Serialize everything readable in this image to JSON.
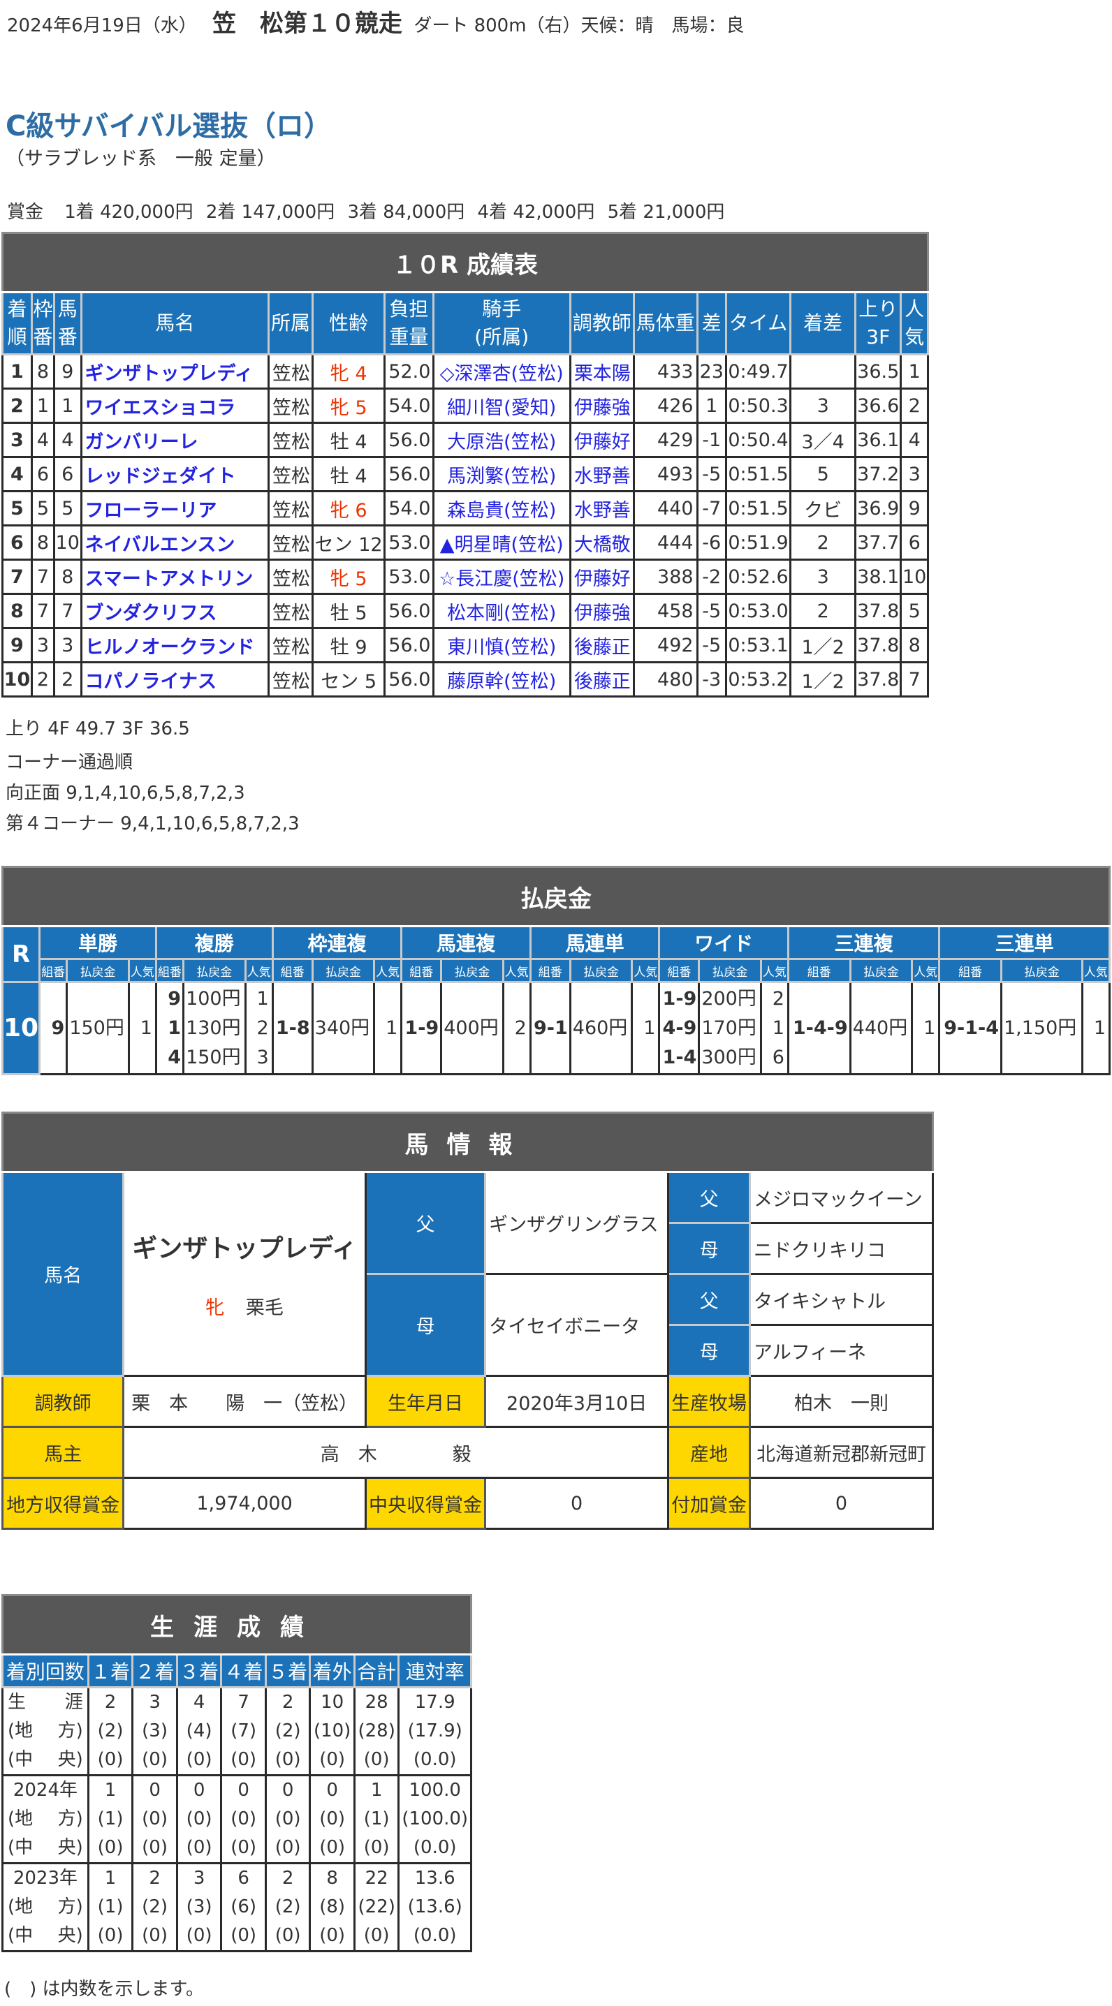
{
  "header": {
    "date": "2024年6月19日（水）",
    "venue_race": "笠　松第１０競走",
    "conditions": "ダート 800m（右）天候：晴　馬場：良",
    "race_name": "C級サバイバル選抜（ロ）",
    "race_class": "（サラブレッド系　一般 定量）",
    "prize_label": "賞金",
    "prizes": [
      "1着 420,000円",
      "2着 147,000円",
      "3着 84,000円",
      "4着 42,000円",
      "5着 21,000円"
    ]
  },
  "results": {
    "title": "１０R 成績表",
    "headers": [
      "着\n順",
      "枠\n番",
      "馬\n番",
      "馬名",
      "所属",
      "性齢",
      "負担\n重量",
      "騎手\n(所属)",
      "調教師",
      "馬体重",
      "差",
      "タイム",
      "着差",
      "上り\n3F",
      "人\n気"
    ],
    "rows": [
      {
        "rank": "1",
        "waku": "8",
        "num": "9",
        "name": "ギンザトップレディ",
        "belong": "笠松",
        "sex": "牝 4",
        "female": true,
        "weight": "52.0",
        "jockey": "◇深澤杏(笠松)",
        "trainer": "栗本陽",
        "body": "433",
        "diff": "23",
        "time": "0:49.7",
        "margin": "",
        "last3f": "36.5",
        "pop": "1"
      },
      {
        "rank": "2",
        "waku": "1",
        "num": "1",
        "name": "ワイエスショコラ",
        "belong": "笠松",
        "sex": "牝 5",
        "female": true,
        "weight": "54.0",
        "jockey": "細川智(愛知)",
        "trainer": "伊藤強",
        "body": "426",
        "diff": "1",
        "time": "0:50.3",
        "margin": "3",
        "last3f": "36.6",
        "pop": "2"
      },
      {
        "rank": "3",
        "waku": "4",
        "num": "4",
        "name": "ガンバリーレ",
        "belong": "笠松",
        "sex": "牡 4",
        "female": false,
        "weight": "56.0",
        "jockey": "大原浩(笠松)",
        "trainer": "伊藤好",
        "body": "429",
        "diff": "-1",
        "time": "0:50.4",
        "margin": "3／4",
        "last3f": "36.1",
        "pop": "4"
      },
      {
        "rank": "4",
        "waku": "6",
        "num": "6",
        "name": "レッドジェダイト",
        "belong": "笠松",
        "sex": "牡 4",
        "female": false,
        "weight": "56.0",
        "jockey": "馬渕繁(笠松)",
        "trainer": "水野善",
        "body": "493",
        "diff": "-5",
        "time": "0:51.5",
        "margin": "5",
        "last3f": "37.2",
        "pop": "3"
      },
      {
        "rank": "5",
        "waku": "5",
        "num": "5",
        "name": "フローラーリア",
        "belong": "笠松",
        "sex": "牝 6",
        "female": true,
        "weight": "54.0",
        "jockey": "森島貴(笠松)",
        "trainer": "水野善",
        "body": "440",
        "diff": "-7",
        "time": "0:51.5",
        "margin": "クビ",
        "last3f": "36.9",
        "pop": "9"
      },
      {
        "rank": "6",
        "waku": "8",
        "num": "10",
        "name": "ネイバルエンスン",
        "belong": "笠松",
        "sex": "セン 12",
        "female": false,
        "weight": "53.0",
        "jockey": "▲明星晴(笠松)",
        "trainer": "大橋敬",
        "body": "444",
        "diff": "-6",
        "time": "0:51.9",
        "margin": "2",
        "last3f": "37.7",
        "pop": "6"
      },
      {
        "rank": "7",
        "waku": "7",
        "num": "8",
        "name": "スマートアメトリン",
        "belong": "笠松",
        "sex": "牝 5",
        "female": true,
        "weight": "53.0",
        "jockey": "☆長江慶(笠松)",
        "trainer": "伊藤好",
        "body": "388",
        "diff": "-2",
        "time": "0:52.6",
        "margin": "3",
        "last3f": "38.1",
        "pop": "10"
      },
      {
        "rank": "8",
        "waku": "7",
        "num": "7",
        "name": "ブンダクリフス",
        "belong": "笠松",
        "sex": "牡 5",
        "female": false,
        "weight": "56.0",
        "jockey": "松本剛(笠松)",
        "trainer": "伊藤強",
        "body": "458",
        "diff": "-5",
        "time": "0:53.0",
        "margin": "2",
        "last3f": "37.8",
        "pop": "5"
      },
      {
        "rank": "9",
        "waku": "3",
        "num": "3",
        "name": "ヒルノオークランド",
        "belong": "笠松",
        "sex": "牡 9",
        "female": false,
        "weight": "56.0",
        "jockey": "東川慎(笠松)",
        "trainer": "後藤正",
        "body": "492",
        "diff": "-5",
        "time": "0:53.1",
        "margin": "1／2",
        "last3f": "37.8",
        "pop": "8"
      },
      {
        "rank": "10",
        "waku": "2",
        "num": "2",
        "name": "コパノライナス",
        "belong": "笠松",
        "sex": "セン 5",
        "female": false,
        "weight": "56.0",
        "jockey": "藤原幹(笠松)",
        "trainer": "後藤正",
        "body": "480",
        "diff": "-3",
        "time": "0:53.2",
        "margin": "1／2",
        "last3f": "37.8",
        "pop": "7"
      }
    ]
  },
  "notes": {
    "last_furlongs": "上り 4F 49.7 3F 36.5",
    "corner_title": "コーナー通過順",
    "corners": [
      "向正面 9,1,4,10,6,5,8,7,2,3",
      "第４コーナー 9,4,1,10,6,5,8,7,2,3"
    ]
  },
  "payout": {
    "title": "払戻金",
    "r_label": "R",
    "race_no": "10",
    "sub_headers": [
      "組番",
      "払戻金",
      "人気"
    ],
    "bets": [
      {
        "name": "単勝",
        "entries": [
          {
            "combo": "9",
            "amount": "150円",
            "pop": "1"
          }
        ]
      },
      {
        "name": "複勝",
        "entries": [
          {
            "combo": "9",
            "amount": "100円",
            "pop": "1"
          },
          {
            "combo": "1",
            "amount": "130円",
            "pop": "2"
          },
          {
            "combo": "4",
            "amount": "150円",
            "pop": "3"
          }
        ]
      },
      {
        "name": "枠連複",
        "entries": [
          {
            "combo": "1-8",
            "amount": "340円",
            "pop": "1"
          }
        ]
      },
      {
        "name": "馬連複",
        "entries": [
          {
            "combo": "1-9",
            "amount": "400円",
            "pop": "2"
          }
        ]
      },
      {
        "name": "馬連単",
        "entries": [
          {
            "combo": "9-1",
            "amount": "460円",
            "pop": "1"
          }
        ]
      },
      {
        "name": "ワイド",
        "entries": [
          {
            "combo": "1-9",
            "amount": "200円",
            "pop": "2"
          },
          {
            "combo": "4-9",
            "amount": "170円",
            "pop": "1"
          },
          {
            "combo": "1-4",
            "amount": "300円",
            "pop": "6"
          }
        ]
      },
      {
        "name": "三連複",
        "entries": [
          {
            "combo": "1-4-9",
            "amount": "440円",
            "pop": "1"
          }
        ]
      },
      {
        "name": "三連単",
        "entries": [
          {
            "combo": "9-1-4",
            "amount": "1,150円",
            "pop": "1"
          }
        ]
      }
    ]
  },
  "horse": {
    "title": "馬情報",
    "name_label": "馬名",
    "name": "ギンザトップレディ",
    "sex": "牝",
    "color": "栗毛",
    "sire_label": "父",
    "dam_label": "母",
    "sire": "ギンザグリングラス",
    "dam": "タイセイボニータ",
    "sire_sire": "メジロマックイーン",
    "sire_dam": "ニドクリキリコ",
    "dam_sire": "タイキシャトル",
    "dam_dam": "アルフィーネ",
    "trainer_label": "調教師",
    "trainer": "栗　本　　陽　一（笠松）",
    "birth_label": "生年月日",
    "birth": "2020年3月10日",
    "breeder_label": "生産牧場",
    "breeder": "柏木　一則",
    "owner_label": "馬主",
    "owner": "高　木　　　　毅",
    "origin_label": "産地",
    "origin": "北海道新冠郡新冠町",
    "local_prize_label": "地方収得賞金",
    "local_prize": "1,974,000",
    "central_prize_label": "中央収得賞金",
    "central_prize": "0",
    "extra_prize_label": "付加賞金",
    "extra_prize": "0"
  },
  "career": {
    "title": "生涯成績",
    "headers": [
      "着別回数",
      "１着",
      "２着",
      "３着",
      "４着",
      "５着",
      "着外",
      "合計",
      "連対率"
    ],
    "groups": [
      {
        "labels": [
          [
            "生",
            "涯"
          ],
          [
            "(地",
            "方)"
          ],
          [
            "(中",
            "央)"
          ]
        ],
        "rows": [
          [
            "2",
            "3",
            "4",
            "7",
            "2",
            "10",
            "28",
            "17.9"
          ],
          [
            "(2)",
            "(3)",
            "(4)",
            "(7)",
            "(2)",
            "(10)",
            "(28)",
            "(17.9)"
          ],
          [
            "(0)",
            "(0)",
            "(0)",
            "(0)",
            "(0)",
            "(0)",
            "(0)",
            "(0.0)"
          ]
        ]
      },
      {
        "labels": [
          [
            "2024年"
          ],
          [
            "(地",
            "方)"
          ],
          [
            "(中",
            "央)"
          ]
        ],
        "rows": [
          [
            "1",
            "0",
            "0",
            "0",
            "0",
            "0",
            "1",
            "100.0"
          ],
          [
            "(1)",
            "(0)",
            "(0)",
            "(0)",
            "(0)",
            "(0)",
            "(1)",
            "(100.0)"
          ],
          [
            "(0)",
            "(0)",
            "(0)",
            "(0)",
            "(0)",
            "(0)",
            "(0)",
            "(0.0)"
          ]
        ]
      },
      {
        "labels": [
          [
            "2023年"
          ],
          [
            "(地",
            "方)"
          ],
          [
            "(中",
            "央)"
          ]
        ],
        "rows": [
          [
            "1",
            "2",
            "3",
            "6",
            "2",
            "8",
            "22",
            "13.6"
          ],
          [
            "(1)",
            "(2)",
            "(3)",
            "(6)",
            "(2)",
            "(8)",
            "(22)",
            "(13.6)"
          ],
          [
            "(0)",
            "(0)",
            "(0)",
            "(0)",
            "(0)",
            "(0)",
            "(0)",
            "(0.0)"
          ]
        ]
      }
    ],
    "footnote": "(　) は内数を示します。"
  },
  "colors": {
    "header_dark": "#575757",
    "header_blue": "#1b72b8",
    "label_yellow": "#ffd700",
    "link_blue": "#2323e0",
    "female_red": "#ee3300",
    "race_title_blue": "#2e6da4"
  }
}
